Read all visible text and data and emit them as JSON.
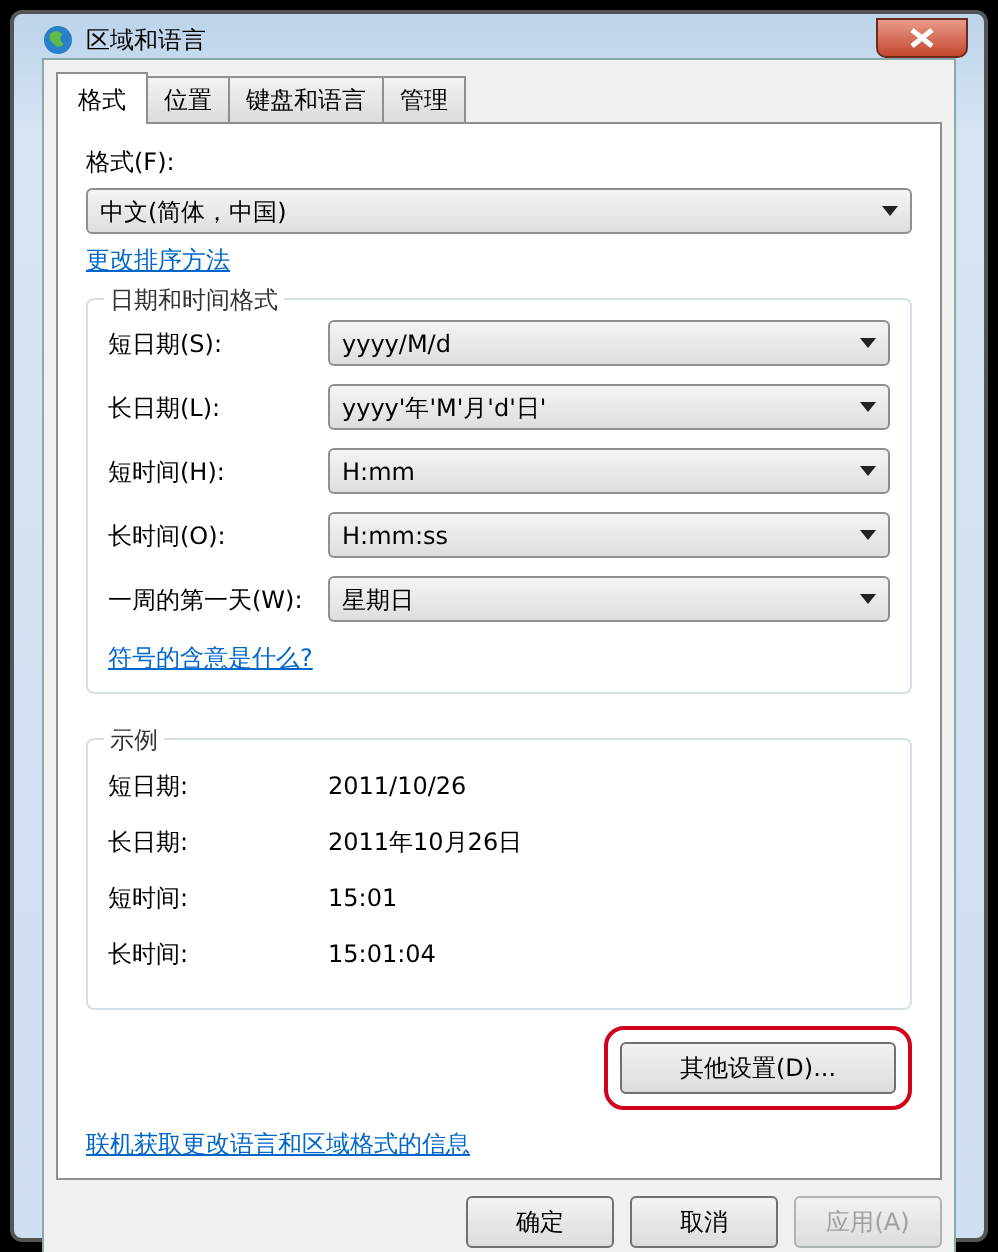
{
  "window": {
    "title": "区域和语言"
  },
  "tabs": [
    {
      "label": "格式",
      "selected": true
    },
    {
      "label": "位置",
      "selected": false
    },
    {
      "label": "键盘和语言",
      "selected": false
    },
    {
      "label": "管理",
      "selected": false
    }
  ],
  "format": {
    "label": "格式(F):",
    "value": "中文(简体，中国)"
  },
  "sort_link": "更改排序方法",
  "date_time_formats": {
    "title": "日期和时间格式",
    "rows": [
      {
        "label": "短日期(S):",
        "value": "yyyy/M/d"
      },
      {
        "label": "长日期(L):",
        "value": "yyyy'年'M'月'd'日'"
      },
      {
        "label": "短时间(H):",
        "value": "H:mm"
      },
      {
        "label": "长时间(O):",
        "value": "H:mm:ss"
      },
      {
        "label": "一周的第一天(W):",
        "value": "星期日"
      }
    ]
  },
  "symbols_link": "符号的含意是什么?",
  "examples": {
    "title": "示例",
    "rows": [
      {
        "label": "短日期:",
        "value": "2011/10/26"
      },
      {
        "label": "长日期:",
        "value": "2011年10月26日"
      },
      {
        "label": "短时间:",
        "value": "15:01"
      },
      {
        "label": "长时间:",
        "value": "15:01:04"
      }
    ]
  },
  "other_settings_button": {
    "label": "其他设置(D)...",
    "highlighted": true
  },
  "online_link": "联机获取更改语言和区域格式的信息",
  "buttons": [
    {
      "label": "确定",
      "disabled": false
    },
    {
      "label": "取消",
      "disabled": false
    },
    {
      "label": "应用(A)",
      "disabled": true
    }
  ]
}
